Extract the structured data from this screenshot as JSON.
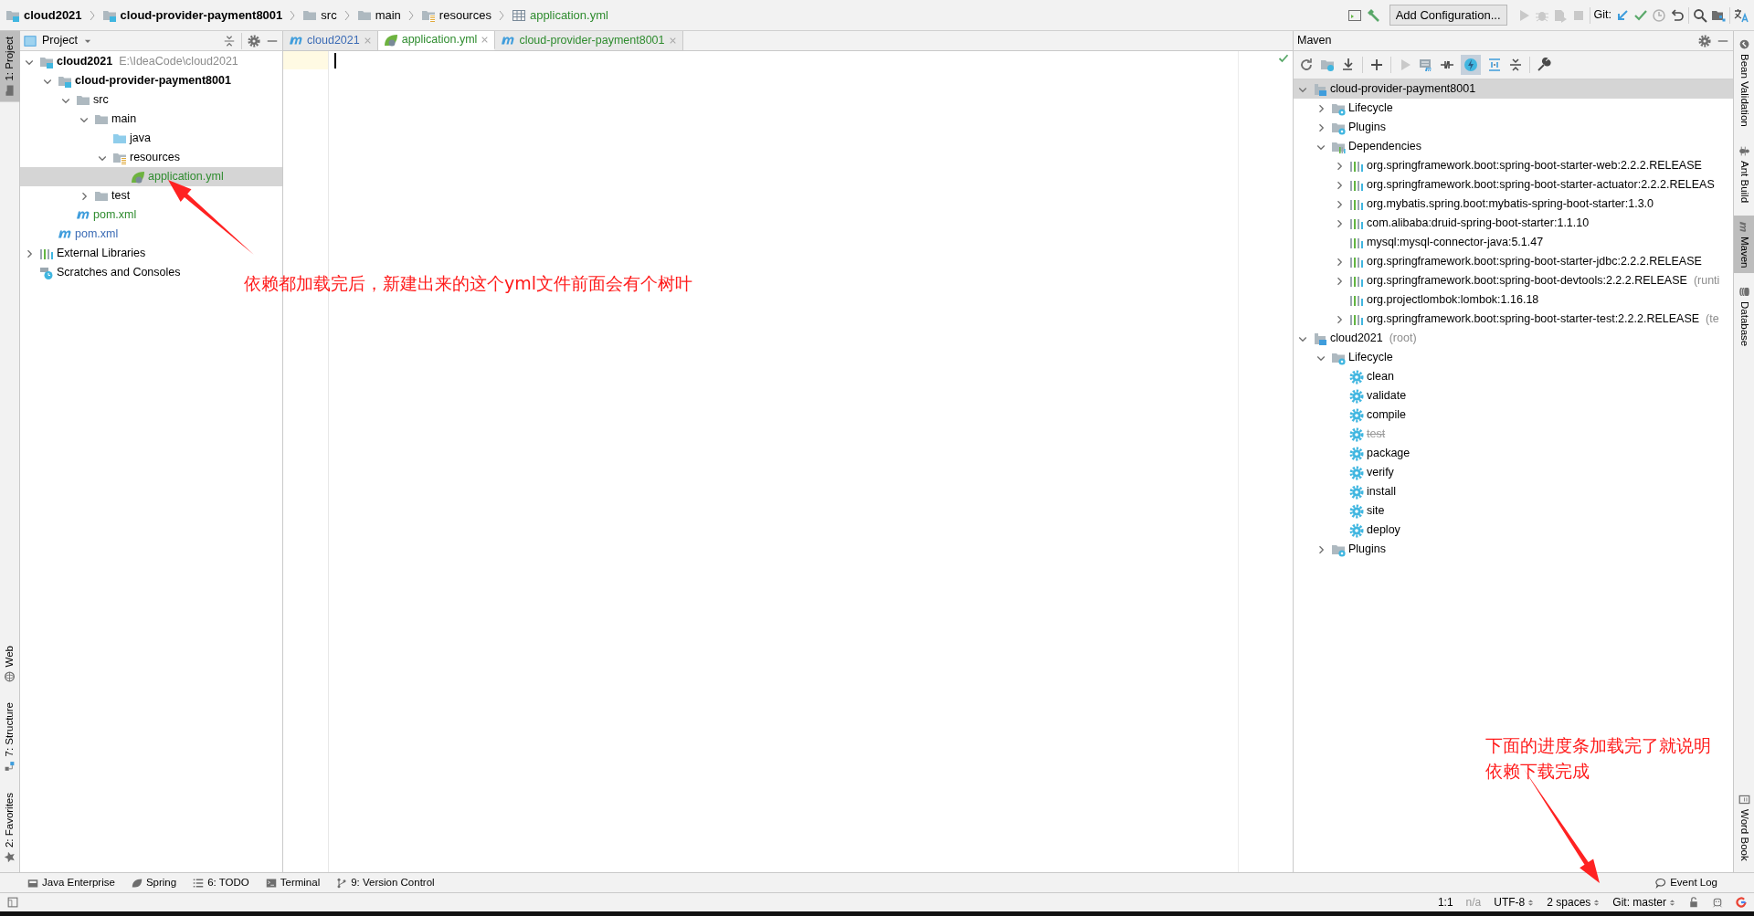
{
  "breadcrumbs": [
    {
      "label": "cloud2021",
      "kind": "module",
      "color": "#000000"
    },
    {
      "label": "cloud-provider-payment8001",
      "kind": "module",
      "color": "#000000"
    },
    {
      "label": "src",
      "kind": "folder",
      "color": "#000000"
    },
    {
      "label": "main",
      "kind": "folder",
      "color": "#000000"
    },
    {
      "label": "resources",
      "kind": "resources",
      "color": "#000000"
    },
    {
      "label": "application.yml",
      "kind": "table",
      "color": "#2f8c2f"
    }
  ],
  "toolbar": {
    "run_config": "Add Configuration...",
    "git_label": "Git:"
  },
  "left_strip": [
    {
      "label": "1: Project",
      "kind": "project",
      "selected": true
    },
    {
      "label": "Web",
      "kind": "web",
      "selected": false
    },
    {
      "label": "7: Structure",
      "kind": "structure",
      "selected": false
    },
    {
      "label": "2: Favorites",
      "kind": "favorites",
      "selected": false
    }
  ],
  "project": {
    "title": "Project",
    "tree": [
      {
        "label": "cloud2021",
        "kind": "module",
        "color": "#000000",
        "hint": "E:\\IdeaCode\\cloud2021",
        "expanded": true,
        "selected": false,
        "children": [
          {
            "label": "cloud-provider-payment8001",
            "kind": "module",
            "color": "#000000",
            "expanded": true,
            "selected": false,
            "children": [
              {
                "label": "src",
                "kind": "folder",
                "expanded": true,
                "selected": false,
                "children": [
                  {
                    "label": "main",
                    "kind": "folder",
                    "expanded": true,
                    "selected": false,
                    "children": [
                      {
                        "label": "java",
                        "kind": "source",
                        "selected": false
                      },
                      {
                        "label": "resources",
                        "kind": "resources",
                        "expanded": true,
                        "selected": false,
                        "children": [
                          {
                            "label": "application.yml",
                            "kind": "yml",
                            "color": "#2f8c2f",
                            "selected": true
                          }
                        ]
                      }
                    ]
                  },
                  {
                    "label": "test",
                    "kind": "folder",
                    "expanded": false,
                    "selected": false
                  }
                ]
              },
              {
                "label": "pom.xml",
                "kind": "maven",
                "color": "#2f8c2f",
                "selected": false
              }
            ]
          },
          {
            "label": "pom.xml",
            "kind": "maven",
            "color": "#3b6bb5",
            "selected": false
          }
        ]
      },
      {
        "label": "External Libraries",
        "kind": "libraries",
        "expanded": false,
        "selected": false
      },
      {
        "label": "Scratches and Consoles",
        "kind": "scratches",
        "selected": false
      }
    ]
  },
  "editor": {
    "tabs": [
      {
        "label": "cloud2021",
        "kind": "maven",
        "color": "#3b6bb5",
        "selected": false
      },
      {
        "label": "application.yml",
        "kind": "yml",
        "color": "#2f8c2f",
        "selected": true
      },
      {
        "label": "cloud-provider-payment8001",
        "kind": "maven",
        "color": "#2f8c2f",
        "selected": false
      }
    ]
  },
  "maven": {
    "title": "Maven",
    "tree": [
      {
        "label": "cloud-provider-payment8001",
        "kind": "mproject",
        "expanded": true,
        "selected": true,
        "children": [
          {
            "label": "Lifecycle",
            "kind": "gearfolder",
            "expanded": false,
            "selected": false
          },
          {
            "label": "Plugins",
            "kind": "gearfolder",
            "expanded": false,
            "selected": false
          },
          {
            "label": "Dependencies",
            "kind": "depfolder",
            "expanded": true,
            "selected": false,
            "children": [
              {
                "label": "org.springframework.boot:spring-boot-starter-web:2.2.2.RELEASE",
                "kind": "dependency",
                "expanded": false,
                "selected": false
              },
              {
                "label": "org.springframework.boot:spring-boot-starter-actuator:2.2.2.RELEAS",
                "kind": "dependency",
                "expanded": false,
                "selected": false
              },
              {
                "label": "org.mybatis.spring.boot:mybatis-spring-boot-starter:1.3.0",
                "kind": "dependency",
                "expanded": false,
                "selected": false
              },
              {
                "label": "com.alibaba:druid-spring-boot-starter:1.1.10",
                "kind": "dependency",
                "expanded": false,
                "selected": false
              },
              {
                "label": "mysql:mysql-connector-java:5.1.47",
                "kind": "dependency",
                "selected": false
              },
              {
                "label": "org.springframework.boot:spring-boot-starter-jdbc:2.2.2.RELEASE",
                "kind": "dependency",
                "expanded": false,
                "selected": false
              },
              {
                "label": "org.springframework.boot:spring-boot-devtools:2.2.2.RELEASE",
                "kind": "dependency",
                "hint": "(runti",
                "expanded": false,
                "selected": false
              },
              {
                "label": "org.projectlombok:lombok:1.16.18",
                "kind": "dependency",
                "selected": false
              },
              {
                "label": "org.springframework.boot:spring-boot-starter-test:2.2.2.RELEASE",
                "kind": "dependency",
                "hint": "(te",
                "expanded": false,
                "selected": false
              }
            ]
          }
        ]
      },
      {
        "label": "cloud2021",
        "kind": "mproject",
        "hint": "(root)",
        "expanded": true,
        "selected": false,
        "children": [
          {
            "label": "Lifecycle",
            "kind": "gearfolder",
            "expanded": true,
            "selected": false,
            "children": [
              {
                "label": "clean",
                "kind": "phase",
                "disabled": false,
                "selected": false
              },
              {
                "label": "validate",
                "kind": "phase",
                "disabled": false,
                "selected": false
              },
              {
                "label": "compile",
                "kind": "phase",
                "disabled": false,
                "selected": false
              },
              {
                "label": "test",
                "kind": "phase",
                "disabled": true,
                "selected": false
              },
              {
                "label": "package",
                "kind": "phase",
                "disabled": false,
                "selected": false
              },
              {
                "label": "verify",
                "kind": "phase",
                "disabled": false,
                "selected": false
              },
              {
                "label": "install",
                "kind": "phase",
                "disabled": false,
                "selected": false
              },
              {
                "label": "site",
                "kind": "phase",
                "disabled": false,
                "selected": false
              },
              {
                "label": "deploy",
                "kind": "phase",
                "disabled": false,
                "selected": false
              }
            ]
          },
          {
            "label": "Plugins",
            "kind": "gearfolder",
            "expanded": false,
            "selected": false
          }
        ]
      }
    ]
  },
  "right_strip": [
    {
      "label": "Bean Validation",
      "kind": "bean",
      "selected": false
    },
    {
      "label": "Ant Build",
      "kind": "ant",
      "selected": false
    },
    {
      "label": "Maven",
      "kind": "maven",
      "selected": true
    },
    {
      "label": "Database",
      "kind": "database",
      "selected": false
    },
    {
      "label": "Word Book",
      "kind": "book",
      "selected": false
    }
  ],
  "bottom_tools": [
    {
      "label": "Java Enterprise",
      "kind": "javaee"
    },
    {
      "label": "Spring",
      "kind": "spring"
    },
    {
      "label": "6: TODO",
      "kind": "todo"
    },
    {
      "label": "Terminal",
      "kind": "terminal"
    },
    {
      "label": "9: Version Control",
      "kind": "vcs"
    }
  ],
  "event_log": "Event Log",
  "status": {
    "position": "1:1",
    "na": "n/a",
    "encoding": "UTF-8",
    "indent": "2 spaces",
    "vcs": "Git: master"
  },
  "annotations": [
    {
      "lines": [
        "依赖都加载完后，新建出来的这个yml文件前面会有个树叶"
      ]
    },
    {
      "lines": [
        "下面的进度条加载完了就说明",
        "依赖下载完成"
      ]
    }
  ]
}
